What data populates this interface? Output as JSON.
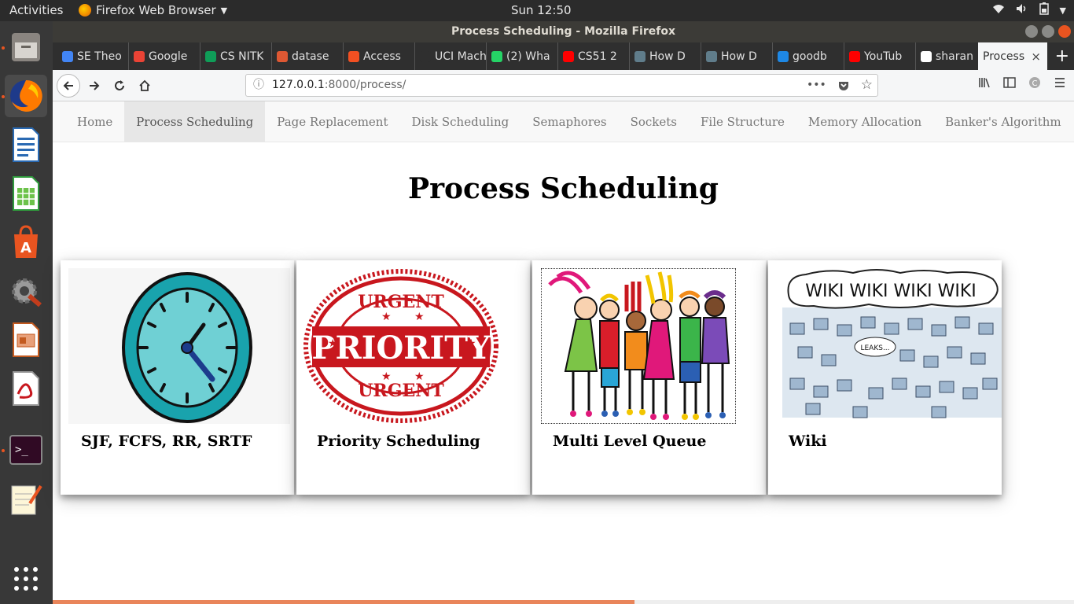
{
  "system": {
    "activities": "Activities",
    "app_menu": "Firefox Web Browser",
    "clock": "Sun 12:50"
  },
  "window": {
    "title": "Process Scheduling - Mozilla Firefox"
  },
  "tabs": [
    {
      "label": "SE Theo",
      "color": "#4285f4"
    },
    {
      "label": "Google",
      "color": "#ea4335"
    },
    {
      "label": "CS NITK",
      "color": "#0f9d58"
    },
    {
      "label": "datase",
      "color": "#de5833"
    },
    {
      "label": "Access",
      "color": "#f25022"
    },
    {
      "label": "UCI Machi",
      "color": "#2f2f2f"
    },
    {
      "label": "(2) Wha",
      "color": "#25d366"
    },
    {
      "label": "CS51 2",
      "color": "#ff0000"
    },
    {
      "label": "How D",
      "color": "#607d8b"
    },
    {
      "label": "How D",
      "color": "#607d8b"
    },
    {
      "label": "goodb",
      "color": "#1e88e5"
    },
    {
      "label": "YouTub",
      "color": "#ff0000"
    },
    {
      "label": "sharan",
      "color": "#ffffff"
    }
  ],
  "current_tab": {
    "label": "Process",
    "close": "×"
  },
  "new_tab": "+",
  "url": {
    "host": "127.0.0.1",
    "rest": ":8000/process/",
    "more": "•••"
  },
  "site_nav": [
    {
      "label": "Home",
      "active": false
    },
    {
      "label": "Process Scheduling",
      "active": true
    },
    {
      "label": "Page Replacement",
      "active": false
    },
    {
      "label": "Disk Scheduling",
      "active": false
    },
    {
      "label": "Semaphores",
      "active": false
    },
    {
      "label": "Sockets",
      "active": false
    },
    {
      "label": "File Structure",
      "active": false
    },
    {
      "label": "Memory Allocation",
      "active": false
    },
    {
      "label": "Banker's Algorithm",
      "active": false
    }
  ],
  "heading": "Process Scheduling",
  "cards": [
    {
      "title": "SJF, FCFS, RR, SRTF",
      "image": "clock-illustration"
    },
    {
      "title": "Priority Scheduling",
      "image": "urgent-priority-stamp",
      "stamp_top": "URGENT",
      "stamp_mid": "PRIORITY",
      "stamp_bottom": "URGENT"
    },
    {
      "title": "Multi Level Queue",
      "image": "queue-of-kids-illustration"
    },
    {
      "title": "Wiki",
      "image": "wiki-leaks-cartoon",
      "bubble": "WIKI WIKI WIKI WIKI",
      "small": "LEAKS..."
    }
  ],
  "page_load_progress": 0.57,
  "colors": {
    "ubuntu_orange": "#e95420",
    "progress": "#e9855a",
    "clock_teal": "#3cbac4",
    "stamp_red": "#c8171e"
  }
}
